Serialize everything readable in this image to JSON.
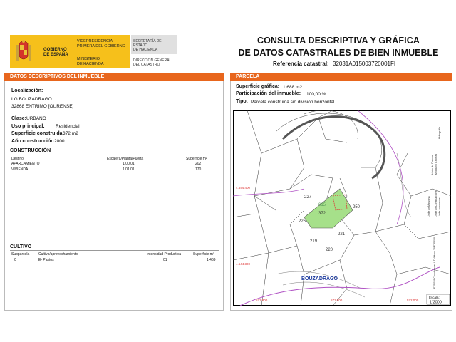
{
  "header": {
    "gov_line1": "GOBIERNO",
    "gov_line2": "DE ESPAÑA",
    "vice_line1": "VICEPRESIDENCIA",
    "vice_line2": "PRIMERA DEL GOBIERNO",
    "ministry_line1": "MINISTERIO",
    "ministry_line2": "DE HACIENDA",
    "secretaria_line1": "SECRETARÍA DE ESTADO",
    "secretaria_line2": "DE HACIENDA",
    "direccion_line1": "DIRECCIÓN GENERAL",
    "direccion_line2": "DEL CATASTRO",
    "title_line1": "CONSULTA DESCRIPTIVA Y GRÁFICA",
    "title_line2": "DE DATOS CATASTRALES DE BIEN INMUEBLE",
    "ref_label": "Referencia catastral:",
    "ref_value": "32031A015003720001FI"
  },
  "left": {
    "heading": "DATOS DESCRIPTIVOS DEL INMUEBLE",
    "localizacion_label": "Localización:",
    "localizacion_line1": "LG BOUZADRAGO",
    "localizacion_line2": "32868 ENTRIMO [OURENSE]",
    "clase_label": "Clase:",
    "clase_value": "URBANO",
    "uso_label": "Uso principal:",
    "uso_value": "Residencial",
    "superficie_label": "Superficie construida:",
    "superficie_value": "372 m2",
    "anio_label": "Año construcción:",
    "anio_value": "2000",
    "construccion": {
      "title": "CONSTRUCCIÓN",
      "col_destino": "Destino",
      "col_escalera": "Escalera/Planta/Puerta",
      "col_superficie": "Superficie m²",
      "rows": [
        {
          "destino": "APARCAMIENTO",
          "escalera": "1/00/01",
          "superficie": "202"
        },
        {
          "destino": "VIVIENDA",
          "escalera": "1/01/01",
          "superficie": "170"
        }
      ]
    },
    "cultivo": {
      "title": "CULTIVO",
      "col_subparcela": "Subparcela",
      "col_cultivo": "Cultivo/aprovechamiento",
      "col_intensidad": "Intensidad Productiva",
      "col_superficie": "Superficie m²",
      "rows": [
        {
          "subparcela": "0",
          "cultivo": "E- Pastos",
          "intensidad": "01",
          "superficie": "1.469"
        }
      ]
    }
  },
  "right": {
    "heading": "PARCELA",
    "sup_grafica_label": "Superficie gráfica:",
    "sup_grafica_value": "1.688 m2",
    "participacion_label": "Participación del inmueble:",
    "participacion_value": "100,00 %",
    "tipo_label": "Tipo:",
    "tipo_value": "Parcela construida sin división horizontal",
    "map": {
      "place_label": "BOUZADRAGO",
      "parcels": [
        "227",
        "015",
        "372",
        "250",
        "226",
        "221",
        "219",
        "220"
      ],
      "coord_y1": "4.644.400",
      "coord_y2": "4.644.300",
      "coord_x1": "571.800",
      "coord_x2": "571.900",
      "coord_x3": "572.000",
      "legend": [
        "Limite de Manzana",
        "Limite de Parcela",
        "Limite de Construcciones",
        "Mobiliario y aceras",
        "Limite zona verde",
        "Hidrografia"
      ],
      "side_text": "ETRS89 Coordenadas UTM Huso 29 ETRS89",
      "scale_label": "Escala:",
      "scale_value": "1/2000"
    }
  },
  "colors": {
    "accent": "#e8661d",
    "gov_yellow": "#f6c01b",
    "parcel_green": "#a6e08a",
    "road_purple": "#b052c4"
  }
}
